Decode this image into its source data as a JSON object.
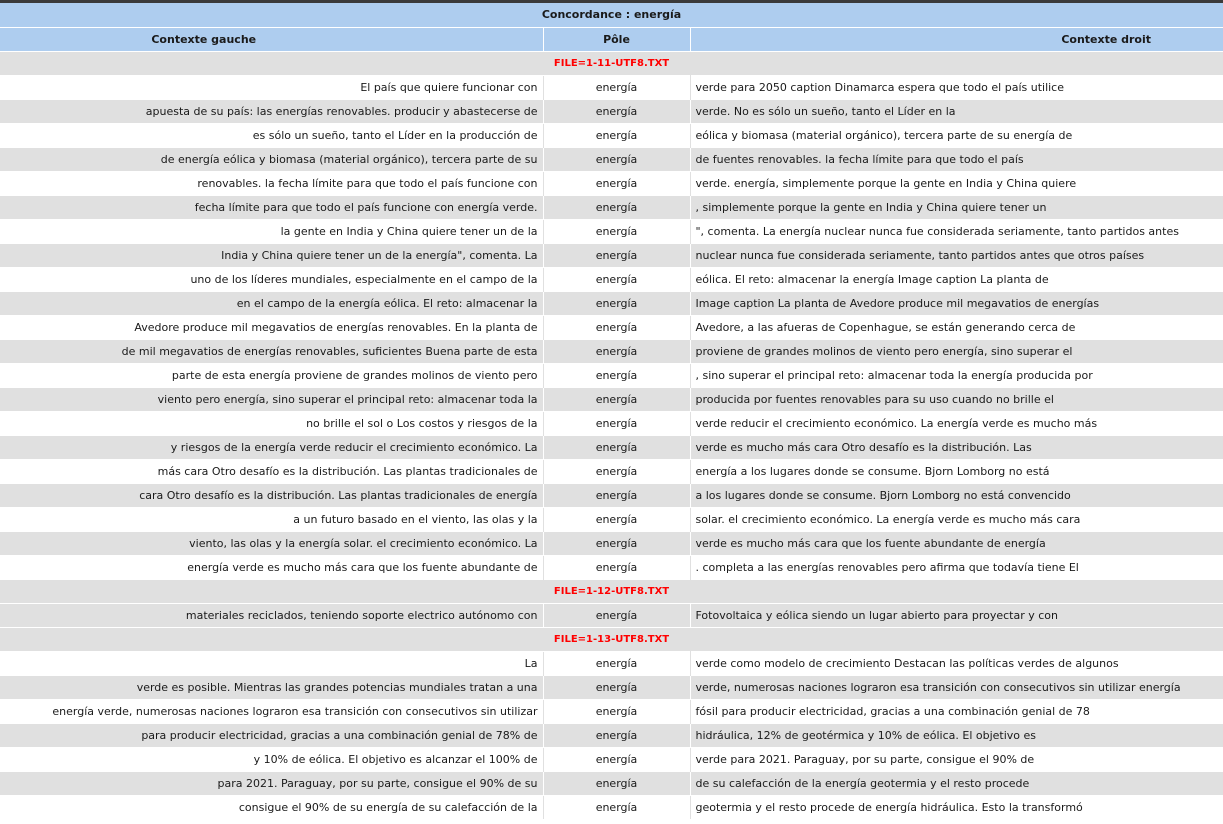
{
  "title": "Concordance : energía",
  "headers": {
    "left": "Contexte gauche",
    "pole": "Pôle",
    "right": "Contexte droit"
  },
  "groups": [
    {
      "file": "FILE=1-11-UTF8.TXT",
      "rows": [
        {
          "left": "El país que quiere funcionar con",
          "pole": "energía",
          "right": "verde para 2050 caption Dinamarca espera que todo el país utilice"
        },
        {
          "left": "apuesta de su país: las energías renovables. producir y abastecerse de",
          "pole": "energía",
          "right": "verde. No es sólo un sueño, tanto el Líder en la"
        },
        {
          "left": "es sólo un sueño, tanto el Líder en la producción de",
          "pole": "energía",
          "right": "eólica y biomasa (material orgánico), tercera parte de su energía de"
        },
        {
          "left": "de energía eólica y biomasa (material orgánico), tercera parte de su",
          "pole": "energía",
          "right": "de fuentes renovables. la fecha límite para que todo el país"
        },
        {
          "left": "renovables. la fecha límite para que todo el país funcione con",
          "pole": "energía",
          "right": "verde. energía, simplemente porque la gente en India y China quiere"
        },
        {
          "left": "fecha límite para que todo el país funcione con energía verde.",
          "pole": "energía",
          "right": ", simplemente porque la gente en India y China quiere tener un"
        },
        {
          "left": "la gente en India y China quiere tener un de la",
          "pole": "energía",
          "right": "\", comenta. La energía nuclear nunca fue considerada seriamente, tanto partidos antes"
        },
        {
          "left": "India y China quiere tener un de la energía\", comenta. La",
          "pole": "energía",
          "right": "nuclear nunca fue considerada seriamente, tanto partidos antes que otros países"
        },
        {
          "left": "uno de los líderes mundiales, especialmente en el campo de la",
          "pole": "energía",
          "right": "eólica. El reto: almacenar la energía Image caption La planta de"
        },
        {
          "left": "en el campo de la energía eólica. El reto: almacenar la",
          "pole": "energía",
          "right": "Image caption La planta de Avedore produce mil megavatios de energías"
        },
        {
          "left": "Avedore produce mil megavatios de energías renovables. En la planta de",
          "pole": "energía",
          "right": "Avedore, a las afueras de Copenhague, se están generando cerca de"
        },
        {
          "left": "de mil megavatios de energías renovables, suficientes Buena parte de esta",
          "pole": "energía",
          "right": "proviene de grandes molinos de viento pero energía, sino superar el"
        },
        {
          "left": "parte de esta energía proviene de grandes molinos de viento pero",
          "pole": "energía",
          "right": ", sino superar el principal reto: almacenar toda la energía producida por"
        },
        {
          "left": "viento pero energía, sino superar el principal reto: almacenar toda la",
          "pole": "energía",
          "right": "producida por fuentes renovables para su uso cuando no brille el"
        },
        {
          "left": "no brille el sol o Los costos y riesgos de la",
          "pole": "energía",
          "right": "verde reducir el crecimiento económico. La energía verde es mucho más"
        },
        {
          "left": "y riesgos de la energía verde reducir el crecimiento económico. La",
          "pole": "energía",
          "right": "verde es mucho más cara Otro desafío es la distribución. Las"
        },
        {
          "left": "más cara Otro desafío es la distribución. Las plantas tradicionales de",
          "pole": "energía",
          "right": "energía a los lugares donde se consume. Bjorn Lomborg no está"
        },
        {
          "left": "cara Otro desafío es la distribución. Las plantas tradicionales de energía",
          "pole": "energía",
          "right": "a los lugares donde se consume. Bjorn Lomborg no está convencido"
        },
        {
          "left": "a un futuro basado en el viento, las olas y la",
          "pole": "energía",
          "right": "solar. el crecimiento económico. La energía verde es mucho más cara"
        },
        {
          "left": "viento, las olas y la energía solar. el crecimiento económico. La",
          "pole": "energía",
          "right": "verde es mucho más cara que los fuente abundante de energía"
        },
        {
          "left": "energía verde es mucho más cara que los fuente abundante de",
          "pole": "energía",
          "right": ". completa a las energías renovables pero afirma que todavía tiene El"
        }
      ]
    },
    {
      "file": "FILE=1-12-UTF8.TXT",
      "rows": [
        {
          "left": "materiales reciclados, teniendo soporte electrico autónomo con",
          "pole": "energía",
          "right": "Fotovoltaica y eólica siendo un lugar abierto para proyectar y con"
        }
      ]
    },
    {
      "file": "FILE=1-13-UTF8.TXT",
      "rows": [
        {
          "left": "La",
          "pole": "energía",
          "right": "verde como modelo de crecimiento Destacan las políticas verdes de algunos"
        },
        {
          "left": "verde es posible. Mientras las grandes potencias mundiales tratan a una",
          "pole": "energía",
          "right": "verde, numerosas naciones lograron esa transición con consecutivos sin utilizar energía"
        },
        {
          "left": "energía verde, numerosas naciones lograron esa transición con consecutivos sin utilizar",
          "pole": "energía",
          "right": "fósil para producir electricidad, gracias a una combinación genial de 78"
        },
        {
          "left": "para producir electricidad, gracias a una combinación genial de 78% de",
          "pole": "energía",
          "right": "hidráulica, 12% de geotérmica y 10% de eólica. El objetivo es"
        },
        {
          "left": "y 10% de eólica. El objetivo es alcanzar el 100% de",
          "pole": "energía",
          "right": "verde para 2021. Paraguay, por su parte, consigue el 90% de"
        },
        {
          "left": "para 2021. Paraguay, por su parte, consigue el 90% de su",
          "pole": "energía",
          "right": "de su calefacción de la energía geotermia y el resto procede"
        },
        {
          "left": "consigue el 90% de su energía de su calefacción de la",
          "pole": "energía",
          "right": "geotermia y el resto procede de energía hidráulica. Esto la transformó"
        }
      ]
    }
  ]
}
